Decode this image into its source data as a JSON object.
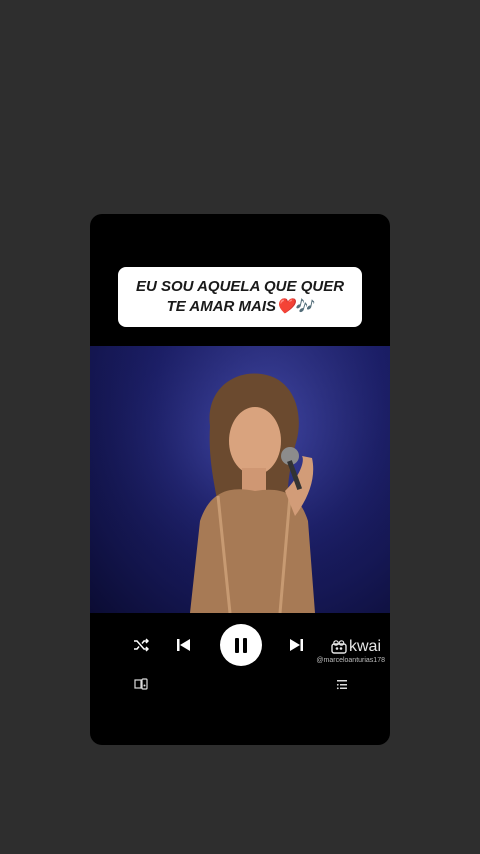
{
  "caption": {
    "line1": "EU SOU AQUELA QUE QUER",
    "line2": "TE AMAR MAIS❤️🎶"
  },
  "player": {
    "is_playing": true
  },
  "watermark": {
    "brand": "kwai",
    "handle": "@marceloanturias178"
  },
  "icons": {
    "shuffle": "shuffle-icon",
    "previous": "skip-previous-icon",
    "pause": "pause-icon",
    "next": "skip-next-icon",
    "devices": "devices-icon",
    "queue": "queue-icon"
  }
}
